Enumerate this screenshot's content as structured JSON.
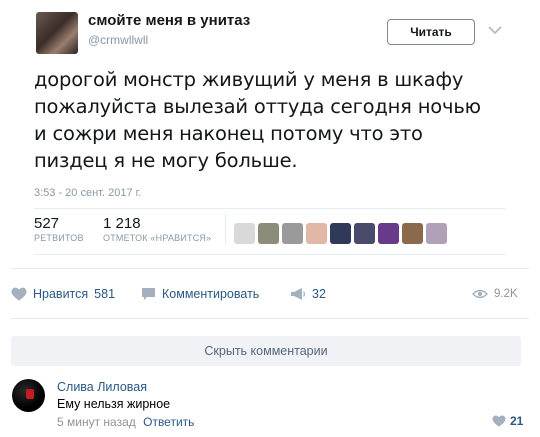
{
  "tweet": {
    "author_name": "смойте меня в унитаз",
    "author_handle": "@crmwllwll",
    "follow_label": "Читать",
    "text": "дорогой монстр живущий у меня в шкафу\nпожалуйста вылезай оттуда сегодня ночью\nи сожри меня наконец потому что это\nпиздец я не могу больше.",
    "timestamp": "3:53 - 20 сент. 2017 г.",
    "retweets": {
      "count": "527",
      "label": "РЕТВИТОВ"
    },
    "likes": {
      "count": "1 218",
      "label": "ОТМЕТОК «НРАВИТСЯ»"
    },
    "liker_colors": [
      "#d9d9d9",
      "#8c8c7a",
      "#9a9a9a",
      "#e3b7a8",
      "#2f3a5a",
      "#4a4a6a",
      "#6a3a8a",
      "#8a6a4a",
      "#b0a0b8"
    ]
  },
  "actions": {
    "like_label": "Нравится",
    "like_count": "581",
    "comment_label": "Комментировать",
    "share_count": "32",
    "views": "9.2K"
  },
  "comments": {
    "hide_label": "Скрыть комментарии",
    "items": [
      {
        "author": "Слива Лиловая",
        "text": "Ему нельзя жирное",
        "time": "5 минут назад",
        "reply_label": "Ответить",
        "likes": "21"
      }
    ]
  },
  "colors": {
    "vk_link": "#2a5885",
    "muted": "#939393",
    "twitter_muted": "#8899a6",
    "button_bg": "#f0f2f5"
  }
}
